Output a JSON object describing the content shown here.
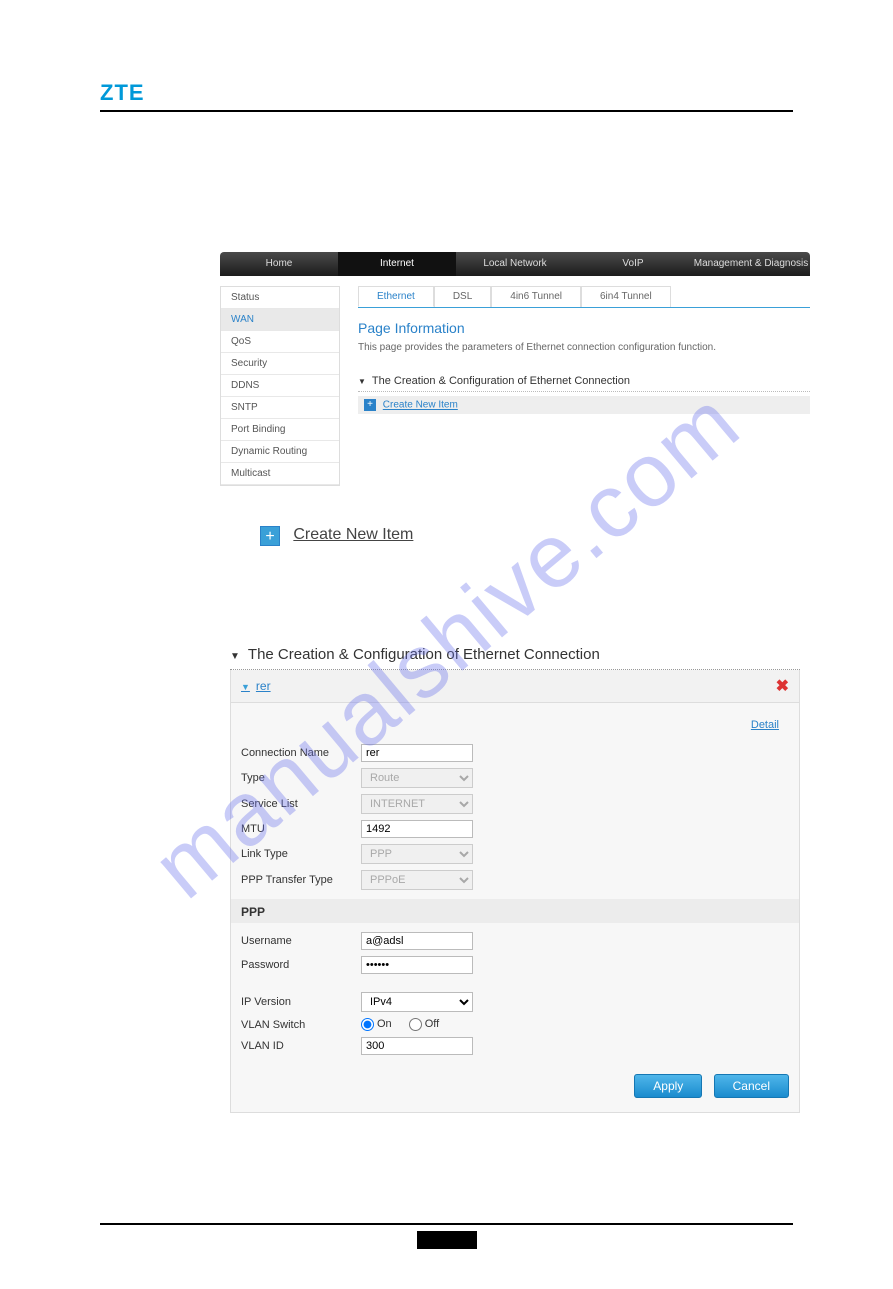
{
  "brand": "ZTE",
  "watermark": "manualshive.com",
  "topnav": [
    "Home",
    "Internet",
    "Local Network",
    "VoIP",
    "Management & Diagnosis"
  ],
  "topnav_active": 1,
  "sidebar": [
    "Status",
    "WAN",
    "QoS",
    "Security",
    "DDNS",
    "SNTP",
    "Port Binding",
    "Dynamic Routing",
    "Multicast"
  ],
  "sidebar_active": 1,
  "subtabs": [
    "Ethernet",
    "DSL",
    "4in6 Tunnel",
    "6in4 Tunnel"
  ],
  "subtabs_active": 0,
  "page_title": "Page Information",
  "page_desc": "This page provides the parameters of Ethernet connection configuration function.",
  "section1_title": "The Creation & Configuration of Ethernet Connection",
  "create_link": "Create New Item",
  "section2_title": "The Creation & Configuration of Ethernet Connection",
  "item_name": "rer",
  "detail_link": "Detail",
  "form": {
    "conn_name_label": "Connection Name",
    "conn_name_value": "rer",
    "type_label": "Type",
    "type_value": "Route",
    "service_label": "Service List",
    "service_value": "INTERNET",
    "mtu_label": "MTU",
    "mtu_value": "1492",
    "linktype_label": "Link Type",
    "linktype_value": "PPP",
    "ppptransfer_label": "PPP Transfer Type",
    "ppptransfer_value": "PPPoE",
    "ppp_header": "PPP",
    "username_label": "Username",
    "username_value": "a@adsl",
    "password_label": "Password",
    "password_value": "••••••",
    "ipver_label": "IP Version",
    "ipver_value": "IPv4",
    "vlansw_label": "VLAN Switch",
    "vlan_on": "On",
    "vlan_off": "Off",
    "vlanid_label": "VLAN ID",
    "vlanid_value": "300"
  },
  "btn_apply": "Apply",
  "btn_cancel": "Cancel"
}
